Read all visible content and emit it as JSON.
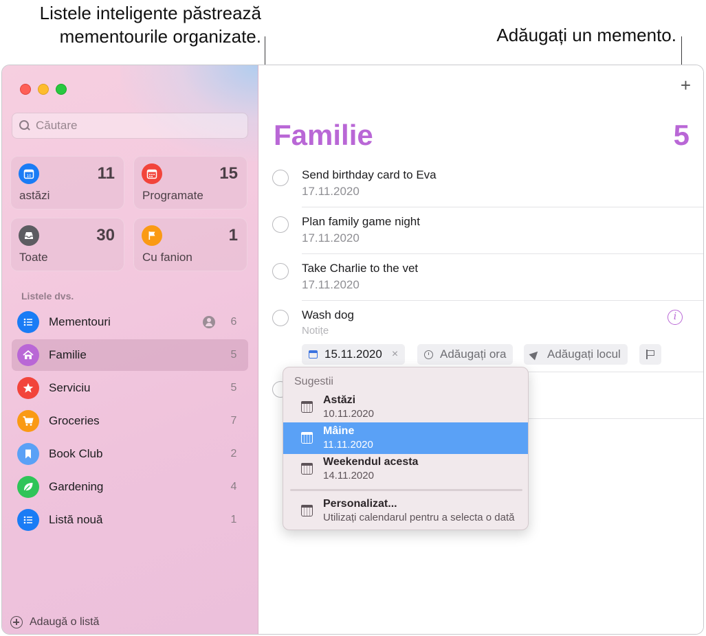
{
  "callouts": {
    "left": "Listele inteligente păstrează mementourile organizate.",
    "right": "Adăugați un memento."
  },
  "sidebar": {
    "search_placeholder": "Căutare",
    "smart_lists": [
      {
        "label": "astăzi",
        "count": "11",
        "icon": "calendar-today-icon",
        "color": "#1a7cf5"
      },
      {
        "label": "Programate",
        "count": "15",
        "icon": "calendar-icon",
        "color": "#f2443b"
      },
      {
        "label": "Toate",
        "count": "30",
        "icon": "tray-icon",
        "color": "#5c5c61"
      },
      {
        "label": "Cu fanion",
        "count": "1",
        "icon": "flag-icon",
        "color": "#fa9a14"
      }
    ],
    "section_title": "Listele dvs.",
    "lists": [
      {
        "label": "Mementouri",
        "count": "6",
        "icon": "list-icon",
        "color": "#1a7cf5",
        "shared": true
      },
      {
        "label": "Familie",
        "count": "5",
        "icon": "house-icon",
        "color": "#b967d6",
        "selected": true
      },
      {
        "label": "Serviciu",
        "count": "5",
        "icon": "star-icon",
        "color": "#f2443b"
      },
      {
        "label": "Groceries",
        "count": "7",
        "icon": "cart-icon",
        "color": "#fa9a14"
      },
      {
        "label": "Book Club",
        "count": "2",
        "icon": "bookmark-icon",
        "color": "#5aa1f6"
      },
      {
        "label": "Gardening",
        "count": "4",
        "icon": "leaf-icon",
        "color": "#2fc458"
      },
      {
        "label": "Listă nouă",
        "count": "1",
        "icon": "list-icon",
        "color": "#1a7cf5"
      }
    ],
    "add_list_label": "Adaugă o listă"
  },
  "main": {
    "add_label": "+",
    "title": "Familie",
    "count": "5",
    "accent": "#b967d6",
    "reminders": [
      {
        "title": "Send birthday card to Eva",
        "date": "17.11.2020"
      },
      {
        "title": "Plan family game night",
        "date": "17.11.2020"
      },
      {
        "title": "Take Charlie to the vet",
        "date": "17.11.2020"
      },
      {
        "title": "Wash dog",
        "notes_placeholder": "Notițe"
      }
    ],
    "chips": {
      "date": "15.11.2020",
      "clear": "×",
      "add_time": "Adăugați ora",
      "add_location": "Adăugați locul",
      "info": "i"
    }
  },
  "popup": {
    "title": "Sugestii",
    "options": [
      {
        "title": "Astăzi",
        "subtitle": "10.11.2020"
      },
      {
        "title": "Mâine",
        "subtitle": "11.11.2020",
        "selected": true
      },
      {
        "title": "Weekendul acesta",
        "subtitle": "14.11.2020"
      },
      {
        "title": "Personalizat...",
        "subtitle": "Utilizați calendarul pentru a selecta o dată"
      }
    ]
  }
}
